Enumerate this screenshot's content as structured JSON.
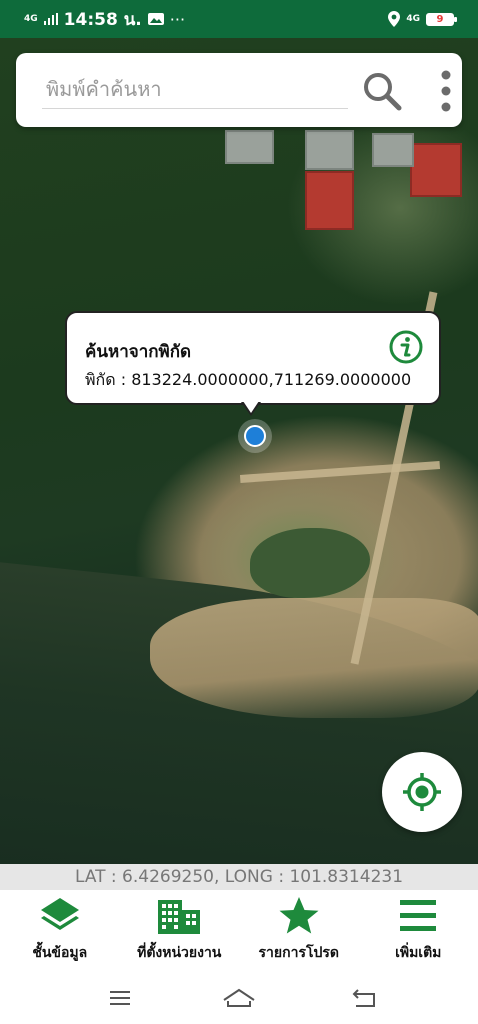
{
  "status_bar": {
    "network_small": "4G",
    "time": "14:58 น.",
    "more": "···",
    "network_right": "4G",
    "battery": "9"
  },
  "search": {
    "placeholder": "พิมพ์คำค้นหา",
    "value": ""
  },
  "popup": {
    "title": "ค้นหาจากพิกัด",
    "coords": "พิกัด : 813224.0000000,711269.0000000"
  },
  "coord_bar": {
    "text": "LAT : 6.4269250, LONG : 101.8314231"
  },
  "bottom_nav": {
    "items": [
      {
        "label": "ชั้นข้อมูล",
        "icon": "layers-icon"
      },
      {
        "label": "ที่ตั้งหน่วยงาน",
        "icon": "building-icon"
      },
      {
        "label": "รายการโปรด",
        "icon": "star-icon"
      },
      {
        "label": "เพิ่มเติม",
        "icon": "menu-icon"
      }
    ]
  },
  "colors": {
    "brand_green": "#1e8a3c",
    "status_bar": "#0e6b3b",
    "marker_blue": "#1e7fd8"
  }
}
